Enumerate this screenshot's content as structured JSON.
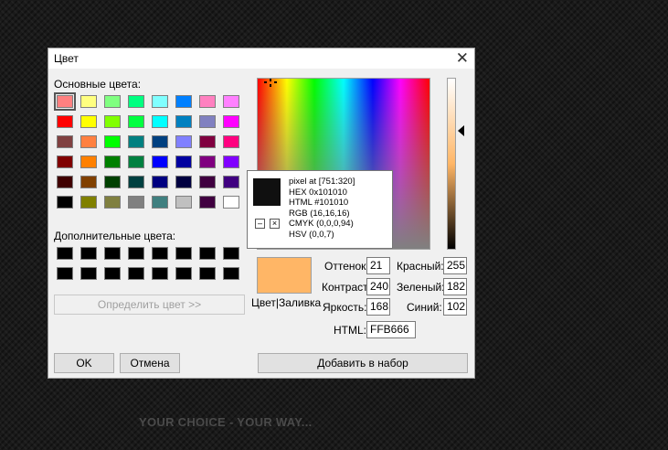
{
  "background": {
    "tagline": "YOUR CHOICE - YOUR WAY..."
  },
  "dialog": {
    "title": "Цвет",
    "basic_colors_label": "Основные цвета:",
    "basic_colors": [
      [
        "#ff8080",
        "#ffff80",
        "#80ff80",
        "#00ff80",
        "#80ffff",
        "#0080ff",
        "#ff80c0",
        "#ff80ff"
      ],
      [
        "#ff0000",
        "#ffff00",
        "#80ff00",
        "#00ff40",
        "#00ffff",
        "#0080c0",
        "#8080c0",
        "#ff00ff"
      ],
      [
        "#804040",
        "#ff8040",
        "#00ff00",
        "#008080",
        "#004080",
        "#8080ff",
        "#800040",
        "#ff0080"
      ],
      [
        "#800000",
        "#ff8000",
        "#008000",
        "#008040",
        "#0000ff",
        "#0000a0",
        "#800080",
        "#8000ff"
      ],
      [
        "#400000",
        "#804000",
        "#004000",
        "#004040",
        "#000080",
        "#000040",
        "#400040",
        "#400080"
      ],
      [
        "#000000",
        "#808000",
        "#808040",
        "#808080",
        "#408080",
        "#c0c0c0",
        "#400040",
        "#ffffff"
      ]
    ],
    "custom_colors_label": "Дополнительные цвета:",
    "define_button": "Определить цвет >>",
    "ok_button": "OK",
    "cancel_button": "Отмена",
    "add_button": "Добавить в набор",
    "preview_label": "Цвет|Заливка",
    "preview_color": "#ffb666",
    "fields": {
      "hue_label": "Оттенок:",
      "hue": "21",
      "sat_label": "Контраст:",
      "sat": "240",
      "lum_label": "Яркость:",
      "lum": "168",
      "red_label": "Красный:",
      "red": "255",
      "green_label": "Зеленый:",
      "green": "182",
      "blue_label": "Синий:",
      "blue": "102",
      "html_label": "HTML:",
      "html": "FFB666"
    }
  },
  "tooltip": {
    "swatch_color": "#101010",
    "lines": [
      "pixel at [751:320]",
      "HEX 0x101010",
      "HTML #101010",
      "RGB (16,16,16)",
      "CMYK (0,0,0,94)",
      "HSV (0,0,7)"
    ],
    "minus_icon": "minus-icon",
    "close_icon": "close-icon"
  }
}
